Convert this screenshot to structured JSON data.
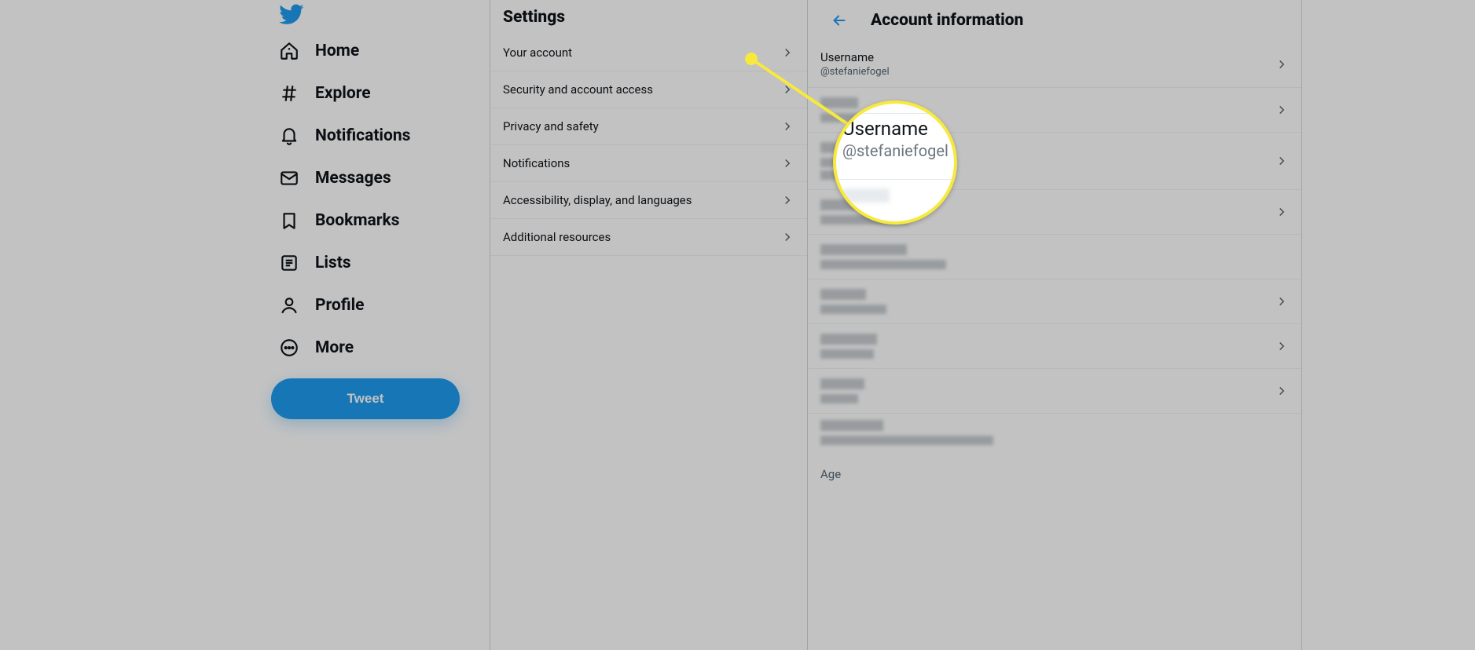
{
  "accent": "#1d9bf0",
  "highlight": "#f7e93e",
  "nav": {
    "items": [
      {
        "label": "Home"
      },
      {
        "label": "Explore"
      },
      {
        "label": "Notifications"
      },
      {
        "label": "Messages"
      },
      {
        "label": "Bookmarks"
      },
      {
        "label": "Lists"
      },
      {
        "label": "Profile"
      },
      {
        "label": "More"
      }
    ],
    "tweet": "Tweet"
  },
  "settings": {
    "title": "Settings",
    "items": [
      "Your account",
      "Security and account access",
      "Privacy and safety",
      "Notifications",
      "Accessibility, display, and languages",
      "Additional resources"
    ]
  },
  "detail": {
    "title": "Account information",
    "username_label": "Username",
    "username_value": "@stefaniefogel",
    "section_label": "Age"
  },
  "callout": {
    "t1": "Username",
    "t2": "@stefaniefogel"
  }
}
